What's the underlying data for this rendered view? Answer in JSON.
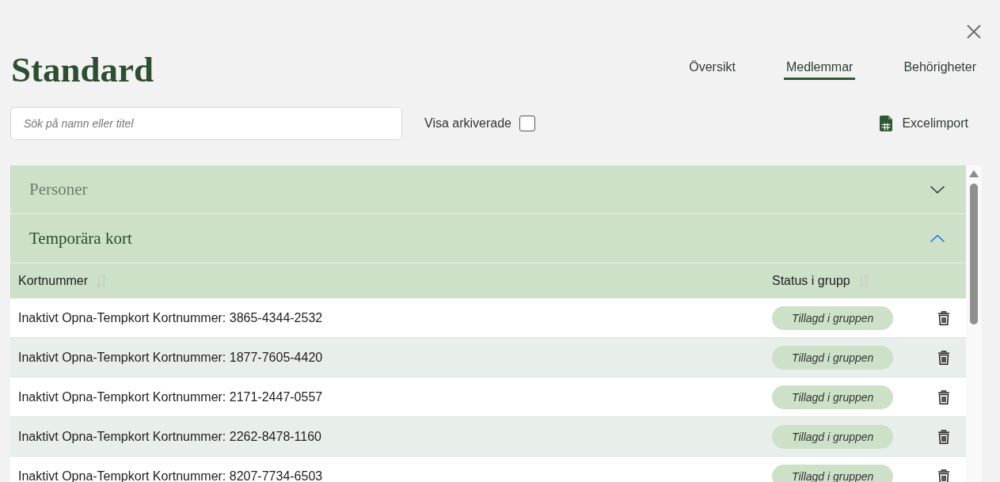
{
  "window": {
    "title": "Standard"
  },
  "tabs": [
    {
      "label": "Översikt",
      "selected": false
    },
    {
      "label": "Medlemmar",
      "selected": true
    },
    {
      "label": "Behörigheter",
      "selected": false
    }
  ],
  "search": {
    "placeholder": "Sök på namn eller titel"
  },
  "archived_toggle": {
    "label": "Visa arkiverade",
    "checked": false
  },
  "import_button": {
    "label": "Excelimport"
  },
  "sections": [
    {
      "title": "Personer",
      "expanded": false
    },
    {
      "title": "Temporära kort",
      "expanded": true,
      "table": {
        "columns": [
          "Kortnummer",
          "Status i grupp"
        ],
        "rows": [
          {
            "card": "Inaktivt Opna-Tempkort Kortnummer: 3865-4344-2532",
            "status": "Tillagd i gruppen"
          },
          {
            "card": "Inaktivt Opna-Tempkort Kortnummer: 1877-7605-4420",
            "status": "Tillagd i gruppen"
          },
          {
            "card": "Inaktivt Opna-Tempkort Kortnummer: 2171-2447-0557",
            "status": "Tillagd i gruppen"
          },
          {
            "card": "Inaktivt Opna-Tempkort Kortnummer: 2262-8478-1160",
            "status": "Tillagd i gruppen"
          },
          {
            "card": "Inaktivt Opna-Tempkort Kortnummer: 8207-7734-6503",
            "status": "Tillagd i gruppen"
          }
        ]
      }
    }
  ]
}
